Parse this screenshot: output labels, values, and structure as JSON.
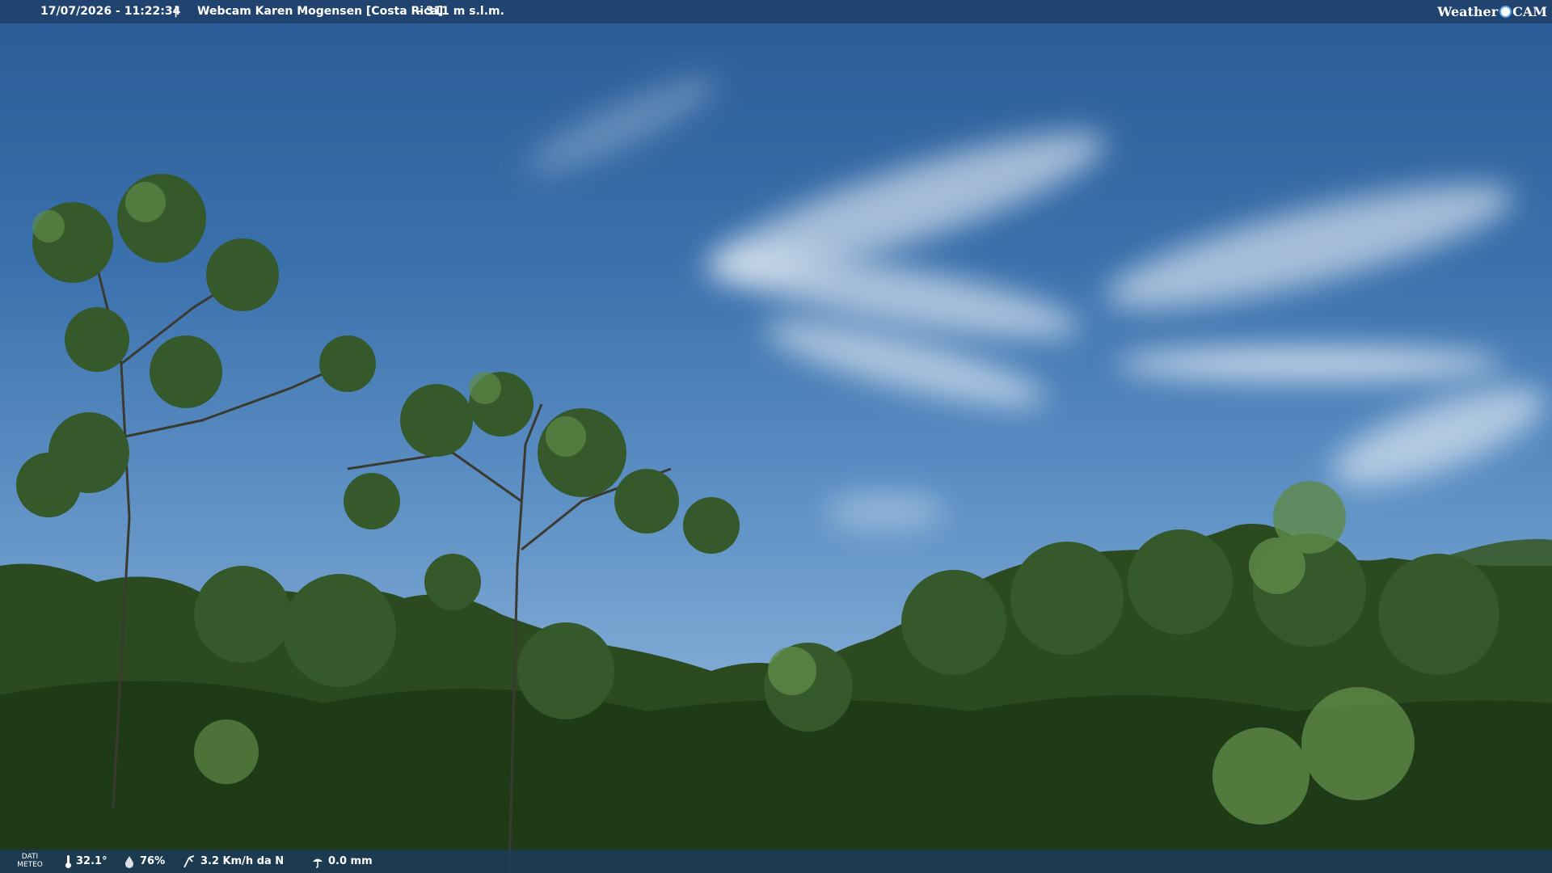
{
  "overlay": {
    "timestamp": "17/07/2026 - 11:22:34",
    "separator": "|",
    "title": "Webcam Karen Mogensen [Costa Rica]",
    "altitude": "- 311 m s.l.m.",
    "brand_left": "Weather",
    "brand_right": "CAM"
  },
  "weather": {
    "label_line1": "DATI",
    "label_line2": "METEO",
    "temperature": "32.1°",
    "humidity": "76%",
    "wind": "3.2 Km/h da N",
    "rain": "0.0 mm"
  },
  "colors": {
    "sky_top": "#2a5c97",
    "sky_horizon": "#9ec0e0",
    "forest_dark": "#1f3a16",
    "forest_mid": "#35592a",
    "forest_light": "#5f8a48",
    "overlay_bar": "#1e3c64"
  },
  "icons": {
    "temperature": "thermometer-icon",
    "humidity": "droplet-icon",
    "wind": "wind-vane-icon",
    "rain": "rain-gauge-icon",
    "brand": "sun-icon"
  }
}
